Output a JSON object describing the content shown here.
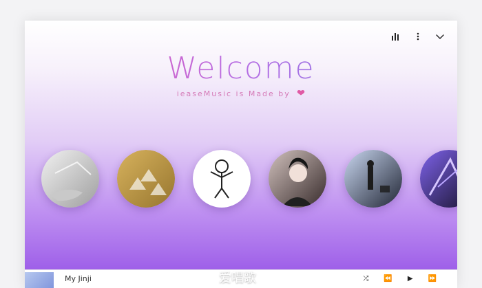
{
  "window": {
    "title_top": "Welcome",
    "subtitle_text": "ieaseMusic is Made by",
    "controls": [
      "bars-chart-icon",
      "more-vertical-icon",
      "chevron-down-icon"
    ]
  },
  "albums": [
    {
      "name": "album-1",
      "colors": [
        "#d9d7d7",
        "#a8a8a8"
      ]
    },
    {
      "name": "album-2",
      "colors": [
        "#cda24d",
        "#a4853a"
      ]
    },
    {
      "name": "album-3",
      "colors": [
        "#ffffff",
        "#222222"
      ]
    },
    {
      "name": "album-4",
      "colors": [
        "#c7b5b0",
        "#3a2f2f"
      ]
    },
    {
      "name": "album-5",
      "colors": [
        "#b8c8e2",
        "#2b3140"
      ]
    },
    {
      "name": "album-6",
      "colors": [
        "#6a4ac7",
        "#1b1531"
      ]
    }
  ],
  "player": {
    "song_title": "My Jinji",
    "controls": [
      "shuffle-icon",
      "rewind-icon",
      "play-icon",
      "fast-forward-icon"
    ]
  },
  "watermark": "爱唱歌"
}
